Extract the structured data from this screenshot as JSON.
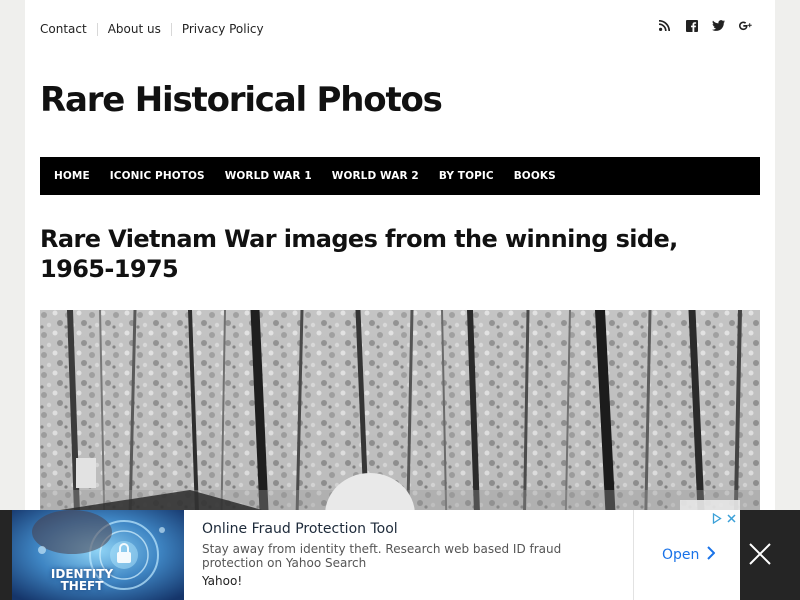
{
  "topbar": {
    "links": [
      "Contact",
      "About us",
      "Privacy Policy"
    ]
  },
  "social": {
    "icons": [
      "rss-icon",
      "facebook-icon",
      "twitter-icon",
      "google-plus-icon"
    ]
  },
  "site": {
    "title": "Rare Historical Photos"
  },
  "nav": {
    "items": [
      "HOME",
      "ICONIC PHOTOS",
      "WORLD WAR 1",
      "WORLD WAR 2",
      "BY TOPIC",
      "BOOKS"
    ]
  },
  "article": {
    "title": "Rare Vietnam War images from the winning side, 1965-1975"
  },
  "ad": {
    "image_label_line1": "IDENTITY",
    "image_label_line2": "THEFT",
    "title": "Online Fraud Protection Tool",
    "description": "Stay away from identity theft. Research web based ID fraud protection on Yahoo Search",
    "source": "Yahoo!",
    "cta": "Open",
    "accent": "#1a73e8"
  }
}
